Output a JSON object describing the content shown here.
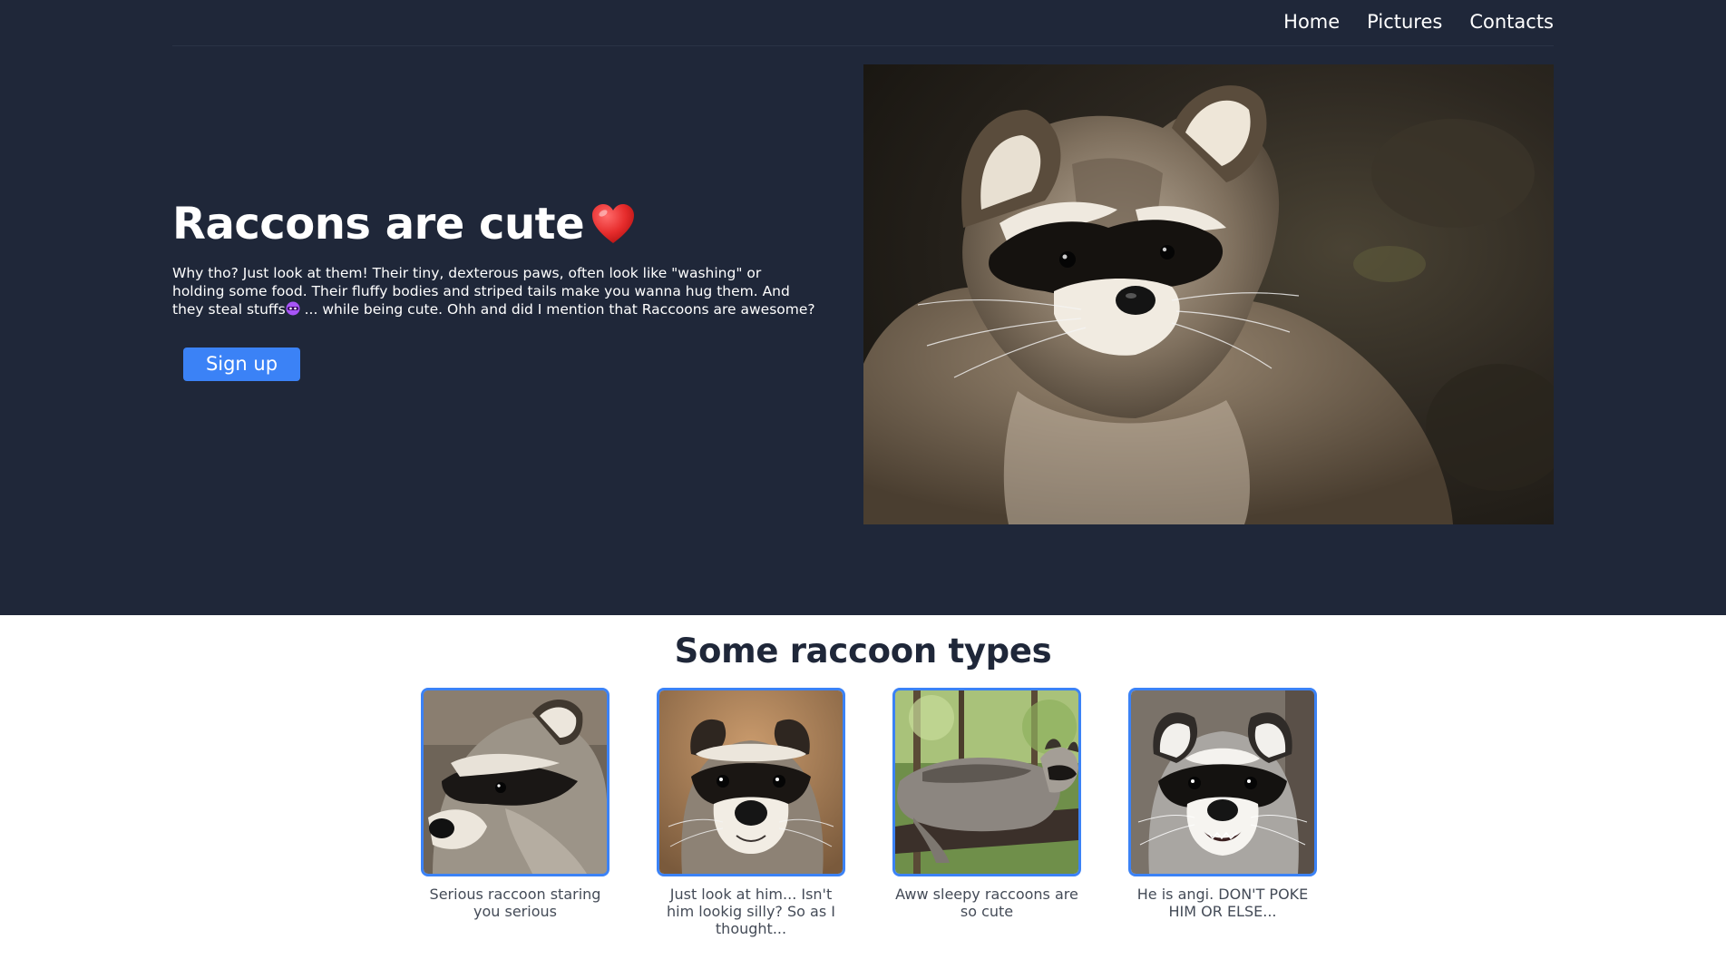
{
  "nav": {
    "links": [
      "Home",
      "Pictures",
      "Contacts"
    ]
  },
  "hero": {
    "title": "Raccons are cute",
    "title_icon": "heart-icon",
    "text_part1": "Why tho? Just look at them! Their tiny, dexterous paws, often look like \"washing\" or holding some food. Their fluffy bodies and striped tails make you wanna hug them. And they steal stuffs",
    "text_icon": "mask-icon",
    "text_part2": " ... while being cute. Ohh and did I mention that Raccoons are awesome?",
    "signup_label": "Sign up",
    "photo": "raccoon-portrait-photo"
  },
  "types": {
    "title": "Some raccoon types",
    "cards": [
      {
        "caption": "Serious raccoon staring you serious",
        "photo": "serious-raccoon-photo"
      },
      {
        "caption": "Just look at him... Isn't him lookig silly? So as I thought...",
        "photo": "silly-raccoon-photo"
      },
      {
        "caption": "Aww sleepy raccoons are so cute",
        "photo": "sleepy-raccoon-photo"
      },
      {
        "caption": "He is angi. DON'T POKE HIM OR ELSE...",
        "photo": "angry-raccoon-photo"
      }
    ]
  },
  "colors": {
    "hero_bg": "#1f2739",
    "accent": "#3b82f6",
    "text_light": "#ffffff",
    "text_dark": "#1f2739"
  }
}
